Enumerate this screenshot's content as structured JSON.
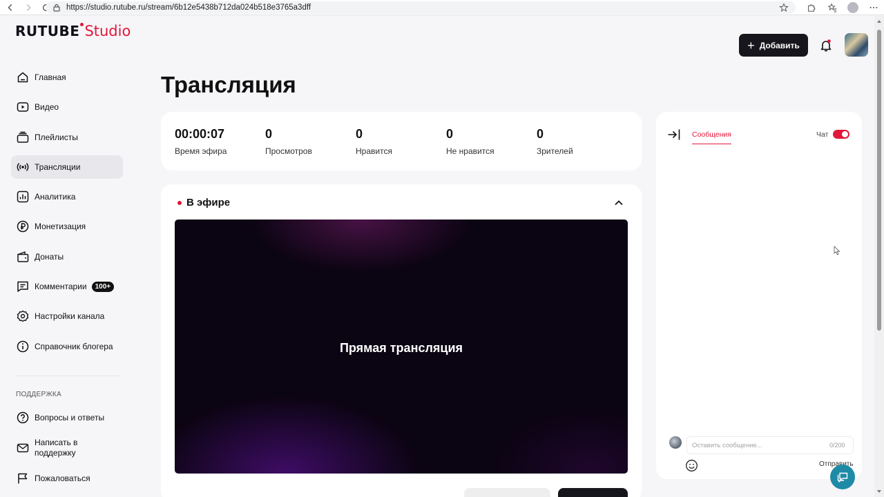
{
  "browser": {
    "url": "https://studio.rutube.ru/stream/6b12e5438b712da024b518e3765a3dff"
  },
  "logo": {
    "word": "RUTUBE",
    "studio": "Studio"
  },
  "sidebar": {
    "items": [
      {
        "label": "Главная",
        "icon": "home-icon"
      },
      {
        "label": "Видео",
        "icon": "video-icon"
      },
      {
        "label": "Плейлисты",
        "icon": "playlist-icon"
      },
      {
        "label": "Трансляции",
        "icon": "broadcast-icon",
        "active": true
      },
      {
        "label": "Аналитика",
        "icon": "analytics-icon"
      },
      {
        "label": "Монетизация",
        "icon": "ruble-icon"
      },
      {
        "label": "Донаты",
        "icon": "wallet-icon"
      },
      {
        "label": "Комментарии",
        "icon": "comment-icon",
        "badge": "100+"
      },
      {
        "label": "Настройки канала",
        "icon": "gear-icon"
      },
      {
        "label": "Справочник блогера",
        "icon": "info-icon"
      }
    ],
    "support_title": "ПОДДЕРЖКА",
    "support_items": [
      {
        "label": "Вопросы и ответы",
        "icon": "question-icon"
      },
      {
        "label": "Написать в поддержку",
        "icon": "mail-icon"
      },
      {
        "label": "Пожаловаться",
        "icon": "flag-icon"
      }
    ]
  },
  "header": {
    "add_label": "Добавить"
  },
  "main": {
    "title": "Трансляция",
    "stats": [
      {
        "value": "00:00:07",
        "label": "Время эфира"
      },
      {
        "value": "0",
        "label": "Просмотров"
      },
      {
        "value": "0",
        "label": "Нравится"
      },
      {
        "value": "0",
        "label": "Не нравится"
      },
      {
        "value": "0",
        "label": "Зрителей"
      }
    ],
    "status": "В эфире",
    "player_text": "Прямая трансляция"
  },
  "chat": {
    "tab": "Сообщения",
    "toggle_label": "Чат",
    "toggle_on": true,
    "input_placeholder": "Оставить сообщение...",
    "counter": "0/200",
    "send_label": "Отправить"
  },
  "colors": {
    "accent": "#e1173b",
    "dark": "#16161c",
    "help": "#1f8aa6"
  }
}
